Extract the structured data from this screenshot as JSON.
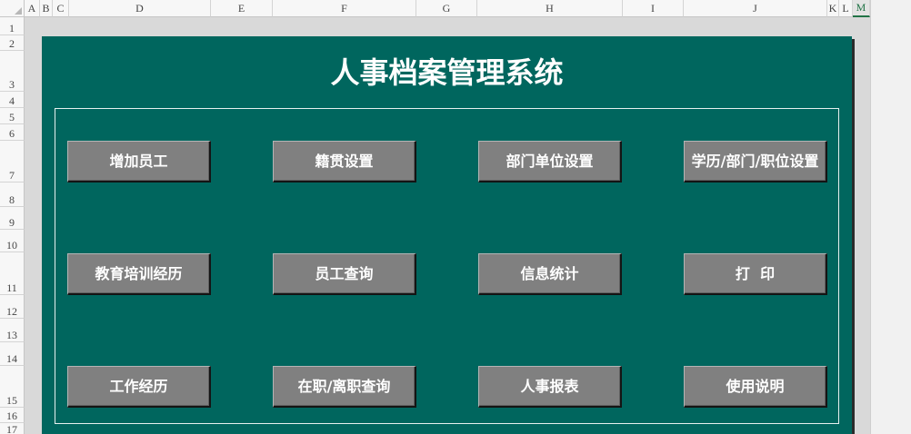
{
  "sheet": {
    "columns": [
      {
        "label": "A"
      },
      {
        "label": "B"
      },
      {
        "label": "C"
      },
      {
        "label": "D"
      },
      {
        "label": "E"
      },
      {
        "label": "F"
      },
      {
        "label": "G"
      },
      {
        "label": "H"
      },
      {
        "label": "I"
      },
      {
        "label": "J"
      },
      {
        "label": "K"
      },
      {
        "label": "L"
      },
      {
        "label": "M",
        "selected": true
      }
    ],
    "rows": [
      "1",
      "2",
      "3",
      "4",
      "5",
      "6",
      "7",
      "8",
      "9",
      "10",
      "11",
      "12",
      "13",
      "14",
      "15",
      "16",
      "17"
    ]
  },
  "dashboard": {
    "title": "人事档案管理系统",
    "buttons": [
      [
        "增加员工",
        "籍贯设置",
        "部门单位设置",
        "学历/部门/职位设置"
      ],
      [
        "教育培训经历",
        "员工查询",
        "信息统计",
        "打  印"
      ],
      [
        "工作经历",
        "在职/离职查询",
        "人事报表",
        "使用说明"
      ]
    ]
  },
  "colors": {
    "panel": "#00665e",
    "button_face": "#808080",
    "button_text": "#ffffff",
    "title_text": "#ffffff",
    "sheet_fill": "#d9d9d9",
    "selected_header": "#217346"
  }
}
